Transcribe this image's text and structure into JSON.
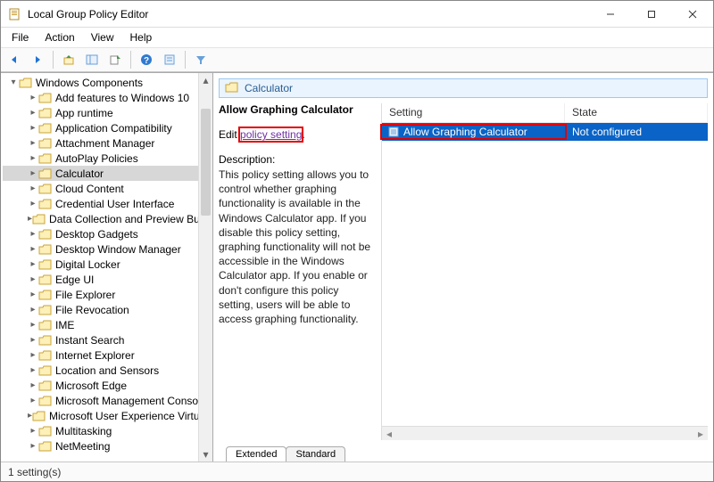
{
  "window": {
    "title": "Local Group Policy Editor"
  },
  "menu": {
    "file": "File",
    "action": "Action",
    "view": "View",
    "help": "Help"
  },
  "tree": {
    "root": "Windows Components",
    "selected": "Calculator",
    "items": [
      "Add features to Windows 10",
      "App runtime",
      "Application Compatibility",
      "Attachment Manager",
      "AutoPlay Policies",
      "Calculator",
      "Cloud Content",
      "Credential User Interface",
      "Data Collection and Preview Builds",
      "Desktop Gadgets",
      "Desktop Window Manager",
      "Digital Locker",
      "Edge UI",
      "File Explorer",
      "File Revocation",
      "IME",
      "Instant Search",
      "Internet Explorer",
      "Location and Sensors",
      "Microsoft Edge",
      "Microsoft Management Console",
      "Microsoft User Experience Virtualiza",
      "Multitasking",
      "NetMeeting"
    ]
  },
  "detail": {
    "header": "Calculator",
    "setting_title": "Allow Graphing Calculator",
    "edit_prefix": "Edit ",
    "edit_link": "policy setting",
    "edit_suffix": ".",
    "description_label": "Description:",
    "description_text": "This policy setting allows you to control whether graphing functionality is available in the Windows Calculator app. If you disable this policy setting, graphing functionality will not be accessible in the Windows Calculator app. If you enable or don't configure this policy setting, users will be able to access graphing functionality."
  },
  "list": {
    "col_setting": "Setting",
    "col_state": "State",
    "rows": [
      {
        "setting": "Allow Graphing Calculator",
        "state": "Not configured"
      }
    ]
  },
  "tabs": {
    "extended": "Extended",
    "standard": "Standard"
  },
  "status": {
    "text": "1 setting(s)"
  }
}
